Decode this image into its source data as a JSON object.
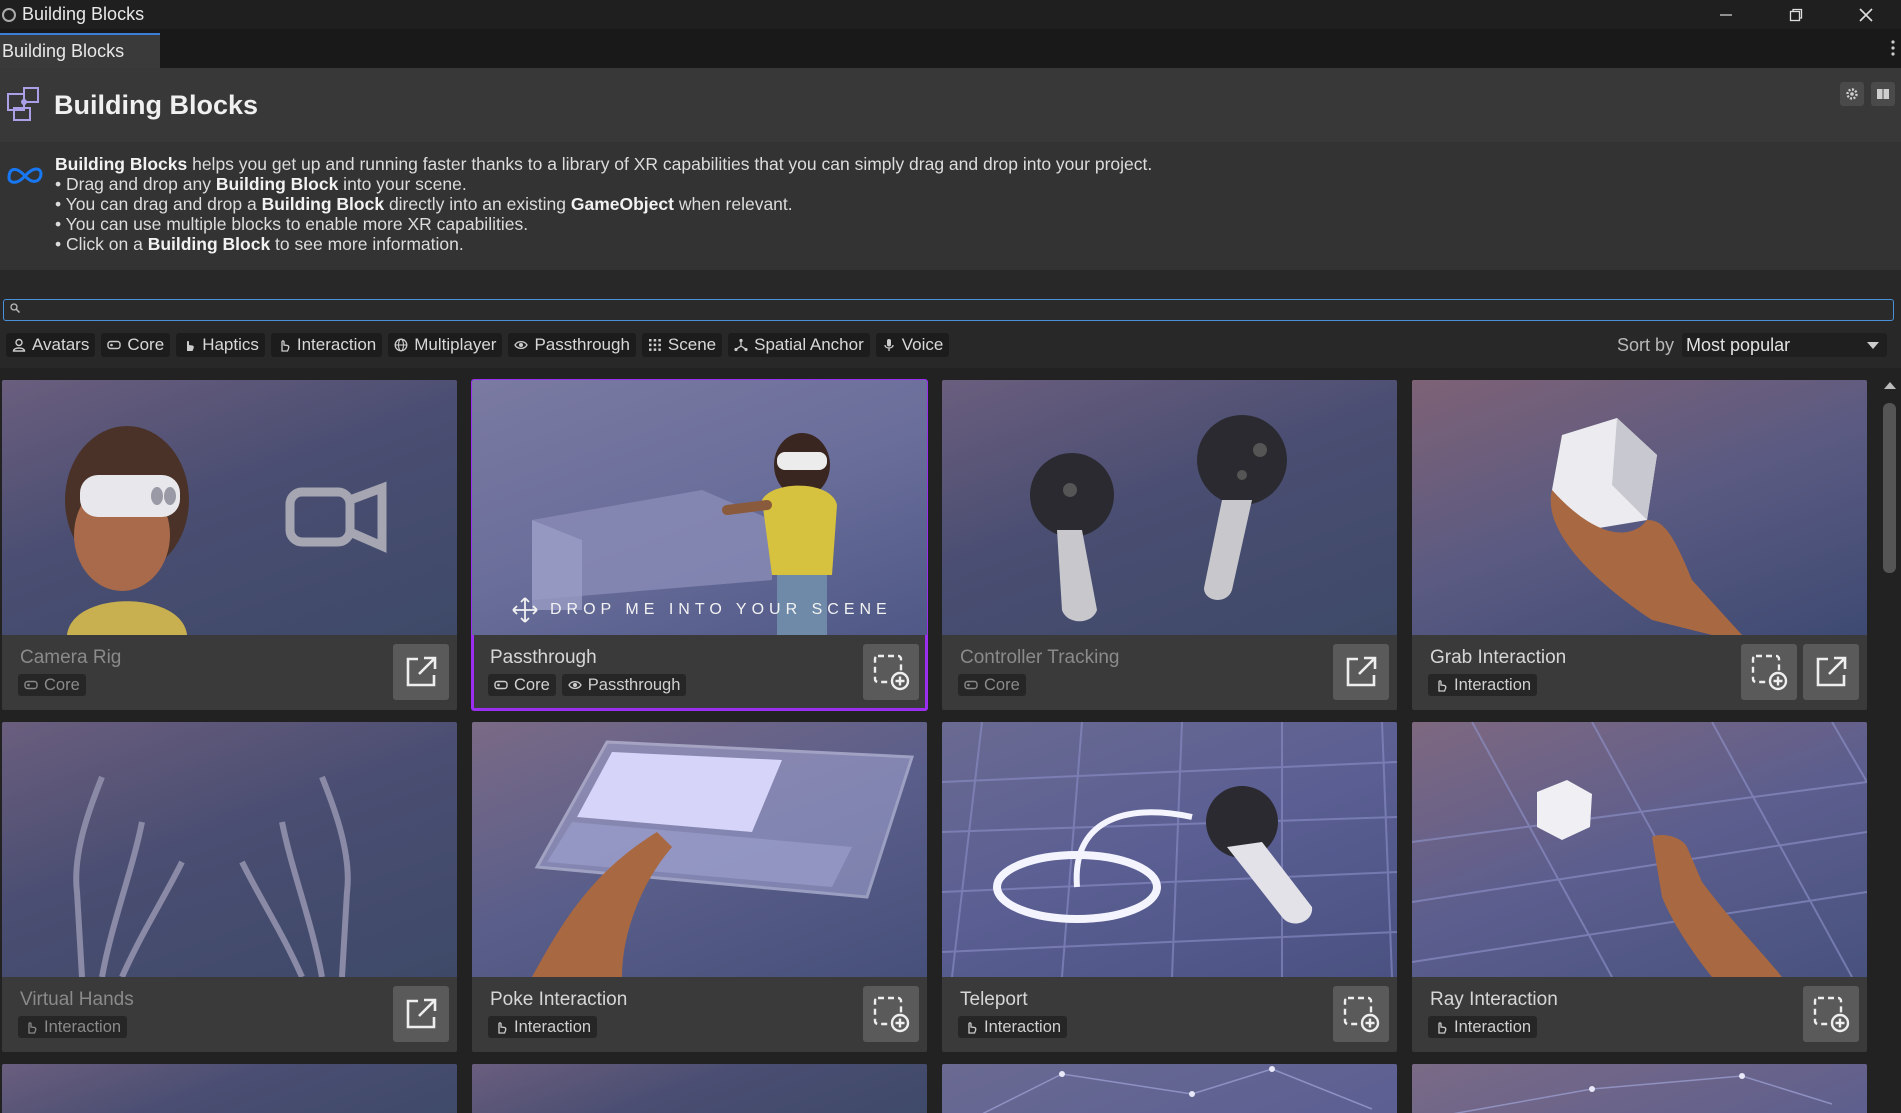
{
  "window": {
    "title": "Building Blocks"
  },
  "tab": {
    "label": "Building Blocks"
  },
  "header": {
    "title": "Building Blocks"
  },
  "info": {
    "intro_bold": "Building Blocks",
    "intro_rest": " helps you get up and running faster thanks to a library of XR capabilities that you can simply drag and drop into your project.",
    "line1_a": "• Drag and drop any ",
    "line1_b": "Building Block",
    "line1_c": " into your scene.",
    "line2_a": "• You can drag and drop a ",
    "line2_b": "Building Block",
    "line2_c": " directly into an existing ",
    "line2_d": "GameObject",
    "line2_e": " when relevant.",
    "line3": "• You can use multiple blocks to enable more XR capabilities.",
    "line4_a": "• Click on a ",
    "line4_b": "Building Block",
    "line4_c": " to see more information."
  },
  "search": {
    "value": "",
    "placeholder": ""
  },
  "filters": [
    "Avatars",
    "Core",
    "Haptics",
    "Interaction",
    "Multiplayer",
    "Passthrough",
    "Scene",
    "Spatial Anchor",
    "Voice"
  ],
  "sort": {
    "label": "Sort by",
    "value": "Most popular"
  },
  "overlay": {
    "drop_message": "DROP ME INTO YOUR SCENE"
  },
  "cards": [
    {
      "name": "Camera Rig",
      "tags": [
        "Core"
      ],
      "installed": true
    },
    {
      "name": "Passthrough",
      "tags": [
        "Core",
        "Passthrough"
      ],
      "installed": false
    },
    {
      "name": "Controller Tracking",
      "tags": [
        "Core"
      ],
      "installed": true
    },
    {
      "name": "Grab Interaction",
      "tags": [
        "Interaction"
      ],
      "installed": false
    },
    {
      "name": "Virtual Hands",
      "tags": [
        "Interaction"
      ],
      "installed": true
    },
    {
      "name": "Poke Interaction",
      "tags": [
        "Interaction"
      ],
      "installed": false
    },
    {
      "name": "Teleport",
      "tags": [
        "Interaction"
      ],
      "installed": false
    },
    {
      "name": "Ray Interaction",
      "tags": [
        "Interaction"
      ],
      "installed": false
    }
  ],
  "colors": {
    "accent": "#4a90d9",
    "selection": "#9b2ff0",
    "meta_blue": "#1877f2"
  }
}
